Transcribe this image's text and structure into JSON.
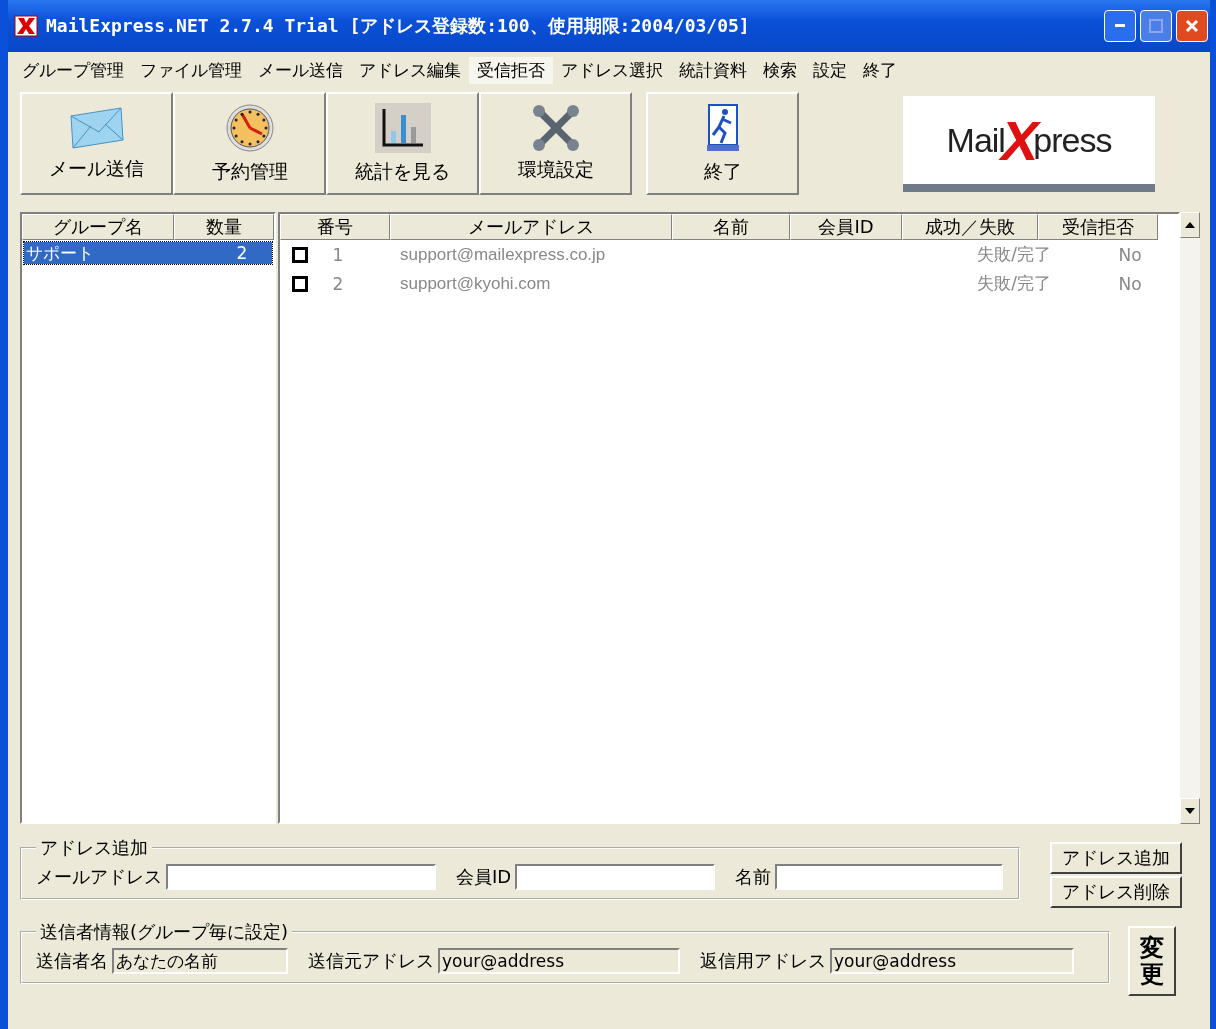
{
  "window": {
    "title": "MailExpress.NET 2.7.4 Trial  [アドレス登録数:100、使用期限:2004/03/05]",
    "maximize_disabled": true
  },
  "menu": [
    {
      "label": "グループ管理",
      "selected": false
    },
    {
      "label": "ファイル管理",
      "selected": false
    },
    {
      "label": "メール送信",
      "selected": false
    },
    {
      "label": "アドレス編集",
      "selected": false
    },
    {
      "label": "受信拒否",
      "selected": true
    },
    {
      "label": "アドレス選択",
      "selected": false
    },
    {
      "label": "統計資料",
      "selected": false
    },
    {
      "label": "検索",
      "selected": false
    },
    {
      "label": "設定",
      "selected": false
    },
    {
      "label": "終了",
      "selected": false
    }
  ],
  "toolbar": [
    {
      "kind": "mail",
      "label": "メール送信"
    },
    {
      "kind": "clock",
      "label": "予約管理"
    },
    {
      "kind": "chart",
      "label": "統計を見る"
    },
    {
      "kind": "tools",
      "label": "環境設定"
    },
    {
      "kind": "exit",
      "label": "終了"
    }
  ],
  "logo": {
    "part_1": "Mail",
    "part_2": "X",
    "part_3": "press"
  },
  "groups": {
    "columns": [
      "グループ名",
      "数量"
    ],
    "rows": [
      {
        "name": "サポート",
        "count": "2",
        "selected": true
      }
    ]
  },
  "table": {
    "columns": [
      "番号",
      "メールアドレス",
      "名前",
      "会員ID",
      "成功／失敗",
      "受信拒否"
    ],
    "rows": [
      {
        "checked": false,
        "number": "1",
        "email": "support@mailexpress.co.jp",
        "status": "失敗/完了",
        "refused": "No"
      },
      {
        "checked": false,
        "number": "2",
        "email": "support@kyohi.com",
        "status": "失敗/完了",
        "refused": "No"
      }
    ]
  },
  "add_address": {
    "legend": "アドレス追加",
    "fields": [
      {
        "label": "メールアドレス"
      },
      {
        "label": "会員ID"
      },
      {
        "label": "名前"
      }
    ],
    "buttons": [
      "アドレス追加",
      "アドレス削除"
    ]
  },
  "sender": {
    "legend": "送信者情報(グループ毎に設定)",
    "fields": [
      {
        "label": "送信者名",
        "value": "あなたの名前",
        "disabled": true
      },
      {
        "label": "送信元アドレス",
        "value": "your@address",
        "disabled": true
      },
      {
        "label": "返信用アドレス",
        "value": "your@address",
        "disabled": true
      }
    ],
    "button": "変更"
  }
}
